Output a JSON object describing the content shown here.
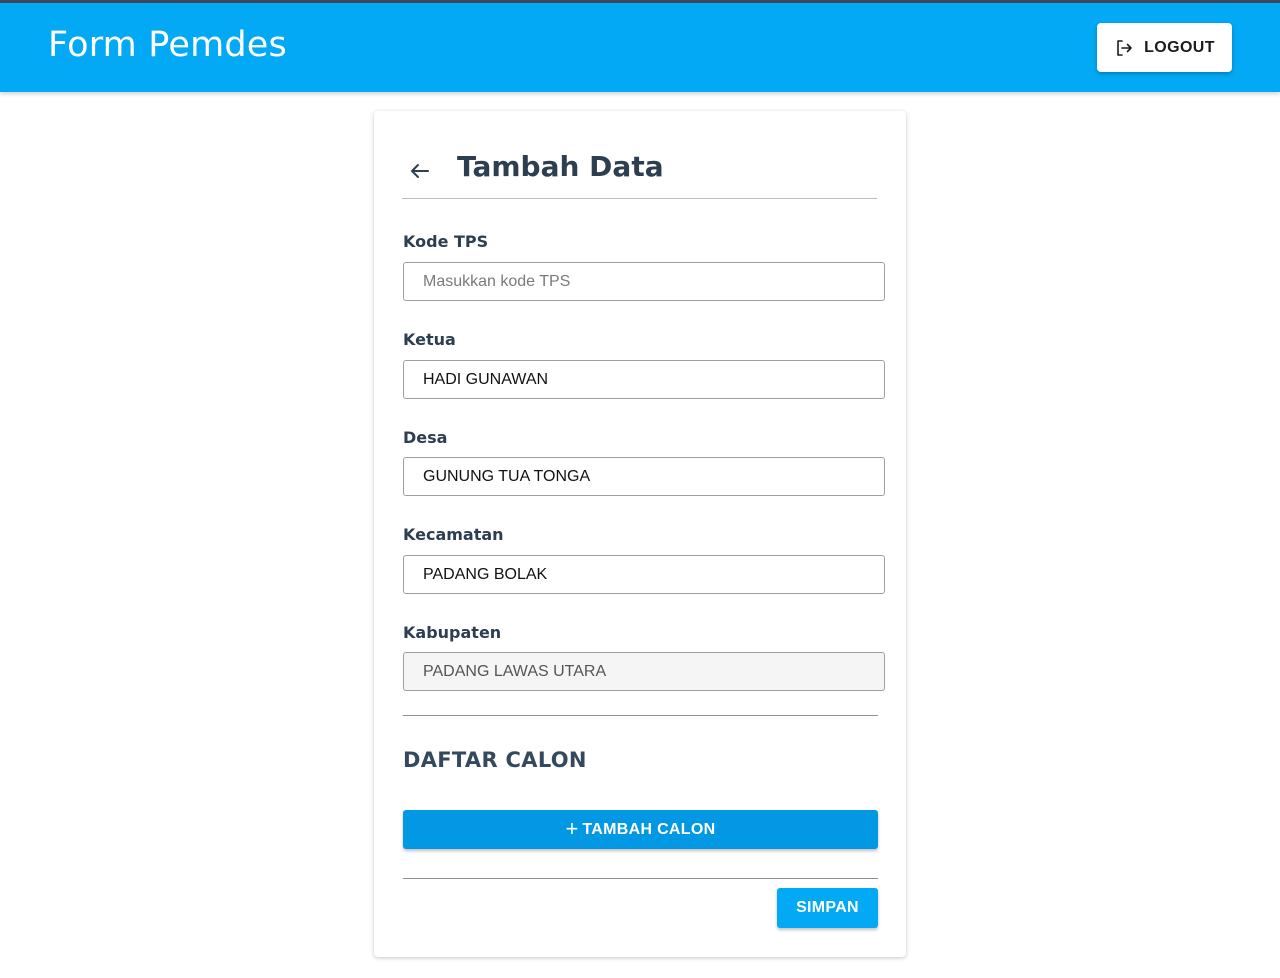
{
  "appbar": {
    "title": "Form Pemdes",
    "logout_label": "LOGOUT",
    "logout_icon": "logout-icon",
    "color": "#03a9f4"
  },
  "form": {
    "title": "Tambah Data",
    "back_icon": "arrow-left-icon",
    "fields": [
      {
        "label": "Kode TPS",
        "value": "",
        "placeholder": "Masukkan kode TPS",
        "disabled": false
      },
      {
        "label": "Ketua",
        "value": "HADI GUNAWAN",
        "placeholder": "",
        "disabled": false
      },
      {
        "label": "Desa",
        "value": "GUNUNG TUA TONGA",
        "placeholder": "",
        "disabled": false
      },
      {
        "label": "Kecamatan",
        "value": "PADANG BOLAK",
        "placeholder": "",
        "disabled": false
      },
      {
        "label": "Kabupaten",
        "value": "PADANG LAWAS UTARA",
        "placeholder": "",
        "disabled": true
      }
    ],
    "section_title": "DAFTAR CALON",
    "add_button_label": "TAMBAH CALON",
    "add_button_icon": "plus-icon",
    "add_button_color": "#0398e3",
    "save_button_label": "SIMPAN",
    "save_button_color": "#03a9f4"
  }
}
